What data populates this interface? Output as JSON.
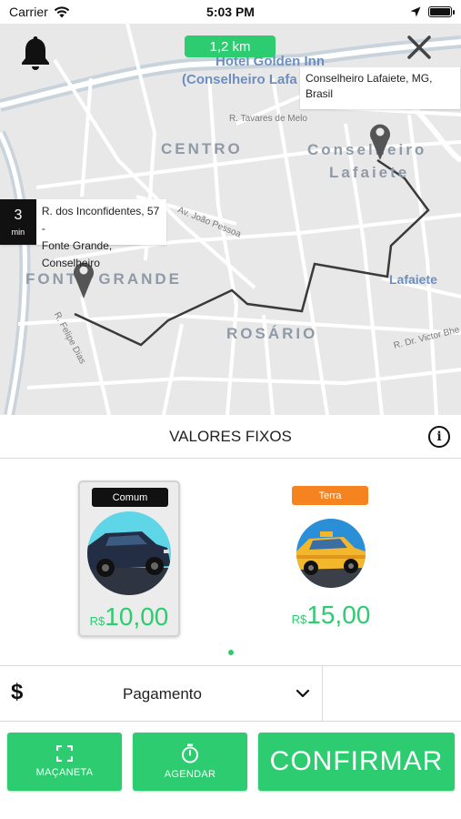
{
  "status_bar": {
    "carrier": "Carrier",
    "time": "5:03 PM",
    "icons": [
      "wifi-icon",
      "location-arrow-icon",
      "battery-icon"
    ]
  },
  "map": {
    "distance": "1,2 km",
    "destination_callout": {
      "line1": "Conselheiro Lafaiete, MG,",
      "line2": "Brasil"
    },
    "origin_callout": {
      "eta_value": "3",
      "eta_unit": "min",
      "line1": "R. dos Inconfidentes, 57 -",
      "line2": "Fonte Grande, Conselheiro"
    },
    "districts": [
      "CENTRO",
      "Conselheiro",
      "Lafaiete",
      "FONTE GRANDE",
      "ROSÁRIO"
    ],
    "pois": {
      "hotel_line1": "Hotel Golden Inn",
      "hotel_line2": "(Conselheiro Lafa",
      "lafaiete": "Lafaiete"
    },
    "streets": {
      "tavares": "R. Tavares de Melo",
      "joao_pessoa": "Av. João Pessoa",
      "felipe_dias": "R. Felipe Dias",
      "victor": "R. Dr. Victor Bhe"
    },
    "route_color": "#3a3a3a",
    "background_color": "#e8e8e8"
  },
  "fixed_values": {
    "title": "VALORES FIXOS",
    "info_icon": "i"
  },
  "options": [
    {
      "badge": "Comum",
      "badge_color": "#111111",
      "currency": "R$",
      "price": "10,00",
      "selected": true
    },
    {
      "badge": "Terra",
      "badge_color": "#f5831f",
      "currency": "R$",
      "price": "15,00",
      "selected": false
    }
  ],
  "payment": {
    "icon": "$",
    "label": "Pagamento"
  },
  "buttons": {
    "macaneta": "MAÇANETA",
    "agendar": "AGENDAR",
    "confirm": "CONFIRMAR"
  },
  "colors": {
    "accent": "#2ecc71",
    "selected_badge": "#111111",
    "terra_badge": "#f5831f"
  }
}
